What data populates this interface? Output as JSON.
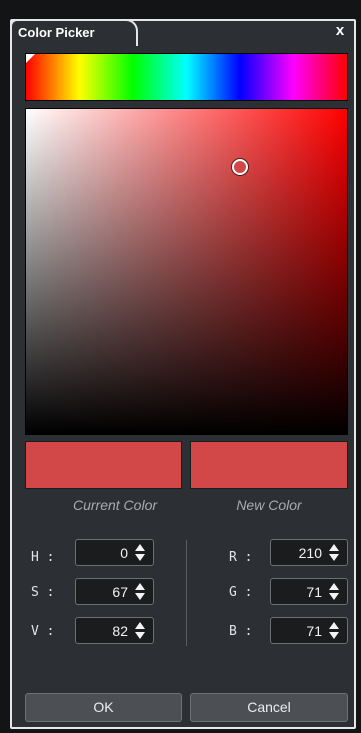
{
  "window": {
    "title": "Color Picker",
    "close_label": "x"
  },
  "hue_bar": {
    "selected_hue": 0
  },
  "sv_area": {
    "saturation": 67,
    "value": 82
  },
  "swatches": {
    "current_label": "Current Color",
    "new_label": "New Color",
    "current_color": "#d24747",
    "new_color": "#d24747"
  },
  "fields": {
    "h": {
      "label": "H :",
      "value": "0"
    },
    "s": {
      "label": "S :",
      "value": "67"
    },
    "v": {
      "label": "V :",
      "value": "82"
    },
    "r": {
      "label": "R :",
      "value": "210"
    },
    "g": {
      "label": "G :",
      "value": "71"
    },
    "b": {
      "label": "B :",
      "value": "71"
    }
  },
  "buttons": {
    "ok_label": "OK",
    "cancel_label": "Cancel"
  },
  "colors": {
    "panel_bg": "#2c2f33",
    "border": "#e6e7e9",
    "field_bg": "#1b1c1e",
    "button_bg": "#4c5055"
  },
  "icons": {
    "close": "close-icon",
    "spin_up": "arrow-up-icon",
    "spin_down": "arrow-down-icon"
  }
}
